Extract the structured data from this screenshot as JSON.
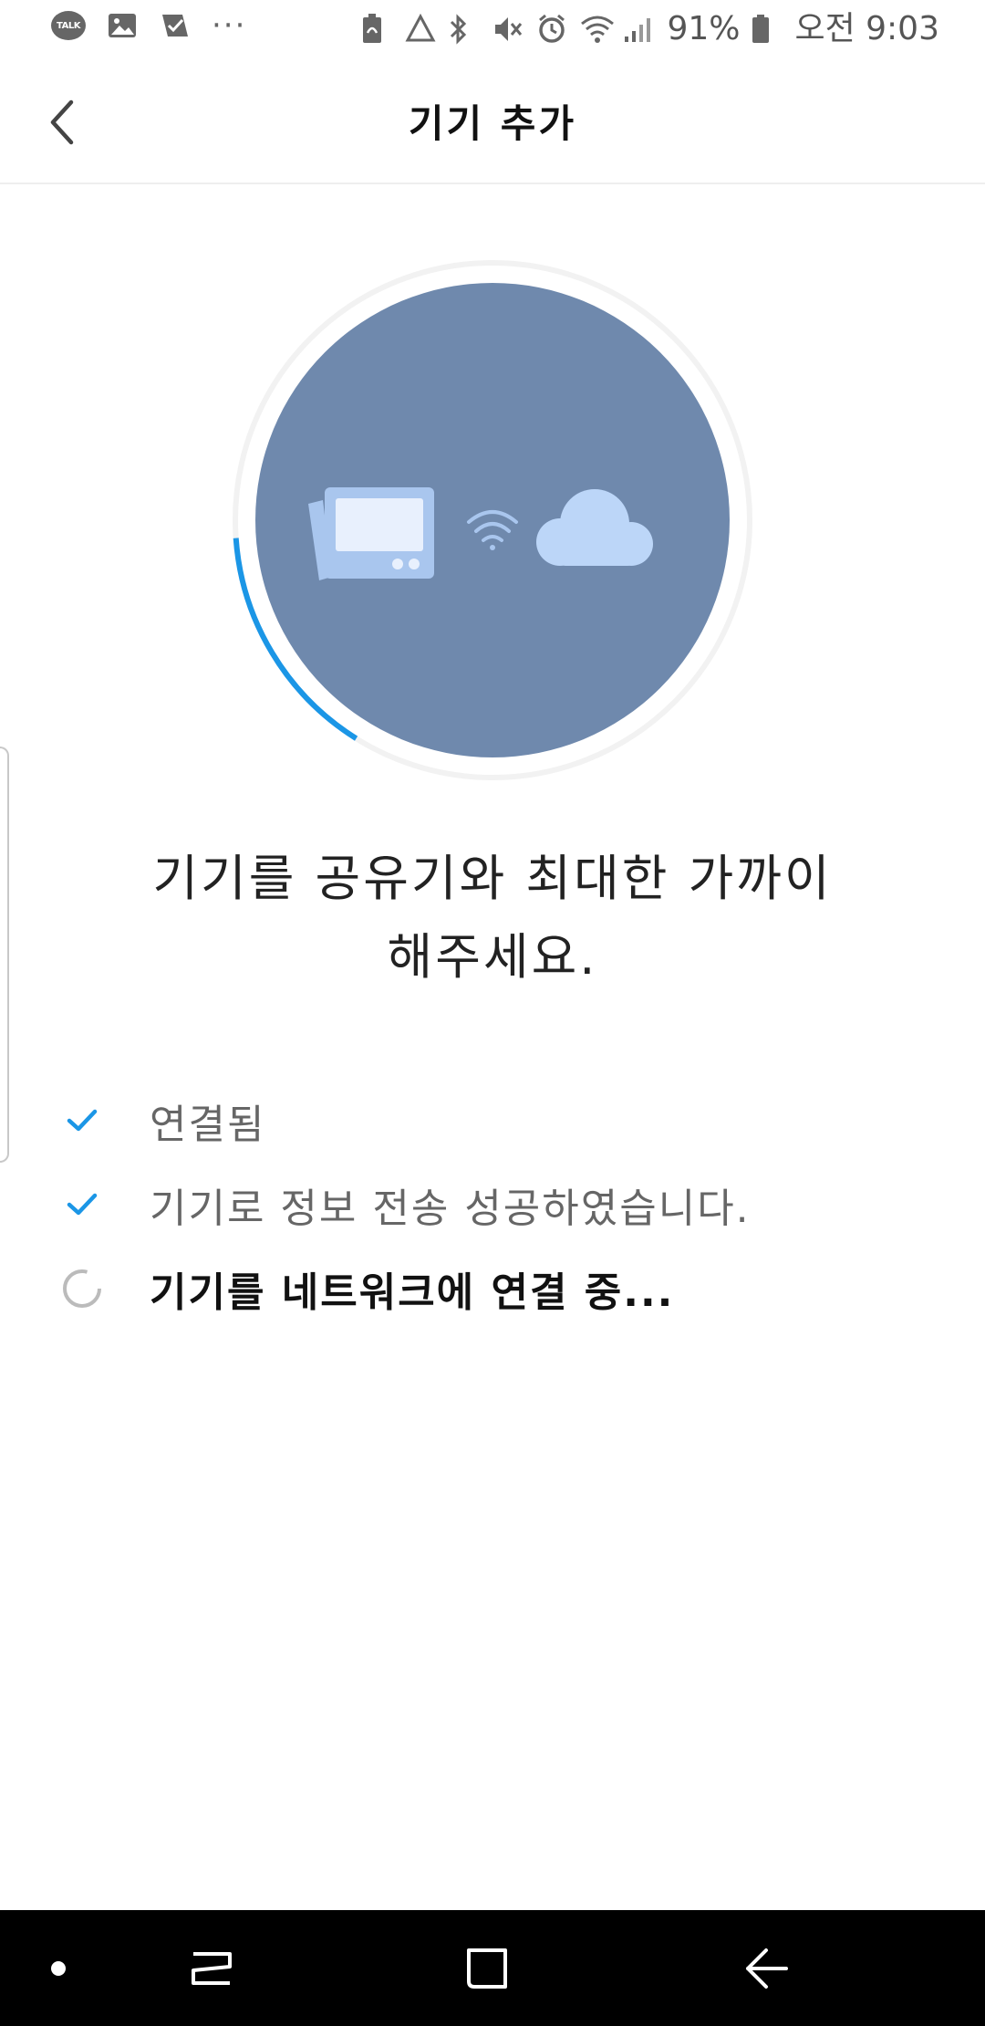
{
  "status_bar": {
    "battery_percent": "91%",
    "time": "오전 9:03",
    "notif_icons": [
      "kakaotalk-icon",
      "gallery-icon",
      "task-icon",
      "more-icon"
    ],
    "talk_label": "TALK",
    "more_label": "···",
    "system_icons": [
      "battery-saver-icon",
      "recycle-icon",
      "bluetooth-icon",
      "mute-icon",
      "alarm-icon",
      "wifi-icon",
      "signal-icon",
      "battery-icon"
    ]
  },
  "app_bar": {
    "title": "기기 추가",
    "back_icon": "chevron-left-icon"
  },
  "illustration": {
    "progress_fraction": 0.15,
    "circle_color": "#6f89ad",
    "progress_color": "#1b96e6",
    "icons": [
      "device-icon",
      "wifi-icon",
      "cloud-icon"
    ]
  },
  "message": {
    "line1": "기기를 공유기와 최대한 가까이",
    "line2": "해주세요."
  },
  "steps": [
    {
      "label": "연결됨",
      "state": "done",
      "icon": "check-icon"
    },
    {
      "label": "기기로 정보 전송 성공하였습니다.",
      "state": "done",
      "icon": "check-icon"
    },
    {
      "label": "기기를 네트워크에 연결 중...",
      "state": "in-progress",
      "icon": "spinner-icon"
    }
  ],
  "nav_bar": {
    "buttons": [
      "dot-icon",
      "recent-apps-icon",
      "home-icon",
      "back-icon"
    ]
  },
  "colors": {
    "accent": "#1b96e6",
    "circle": "#6f89ad",
    "device_light": "#dbe8fb",
    "device_mid": "#a9c6ee"
  }
}
